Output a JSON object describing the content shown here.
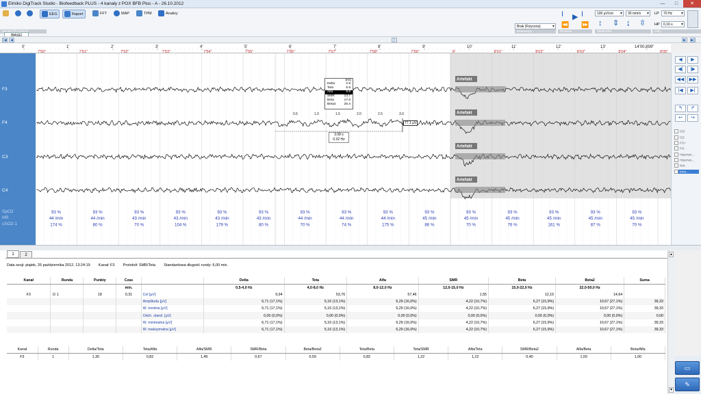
{
  "titlebar": {
    "title": "Elmiko DigiTrack Studio  -  Biofeedback PLUS  -  4 kanały z POX BFB Plus  -  A  -  26.10.2012",
    "minimize": "—",
    "maximize": "□",
    "close": "✕"
  },
  "toolbar": {
    "eeg": "EEG",
    "raport": "Raport",
    "fft": "FFT",
    "map": "MAP",
    "tpm": "TPM",
    "analizy": "Analizy",
    "montage_band": "Montaż [Programy]",
    "base_tab": "[BASE]",
    "referencja_select": "Brak (Fizyczna)",
    "referencja_band": "Referencja",
    "przesuw_band": "Przesuw",
    "skala_band": "Skala EEG",
    "filtry_band": "Filtry",
    "sensitivity": "100 µV/cm",
    "speed": "30 mm/s",
    "lp_label": "LP",
    "lp_value": "70 Hz",
    "hp_label": "HP",
    "hp_value": "0,16 s"
  },
  "timescale": {
    "ticks": [
      "0'",
      "1'",
      "2'",
      "3'",
      "4'",
      "5'",
      "6'",
      "7'",
      "8'",
      "9'",
      "10'",
      "11'",
      "12'",
      "13'",
      "14'00,899\""
    ],
    "epochs": [
      "7'50\"",
      "7'51\"",
      "7'52\"",
      "7'53\"",
      "7'54\"",
      "7'55\"",
      "7'56\"",
      "7'57\"",
      "7'58\"",
      "7'59\"",
      "8'",
      "8'01\"",
      "8'02\"",
      "8'03\"",
      "8'04\"",
      "8'05\""
    ]
  },
  "channels": [
    "F3",
    "F4",
    "C3",
    "C4"
  ],
  "artefakt_label": "Artefakt",
  "popup": {
    "unit": "[Hz]",
    "rows": [
      [
        "Delta",
        "2.9"
      ],
      [
        "Teta",
        "5.9"
      ],
      [
        "Alfa",
        "9.8"
      ],
      [
        "SMR",
        "13.7"
      ],
      [
        "Beta",
        "17.6"
      ],
      [
        "Beta2",
        "26.4"
      ]
    ],
    "scale": [
      "0.5",
      "1.0",
      "1.5",
      "2.0",
      "2.5",
      "3.0"
    ],
    "amplitude": "77.1 µV",
    "time": "3.08 s",
    "freq": "0.32 Hz"
  },
  "vitals": {
    "labels": [
      "SpO2",
      "HR",
      "cSO2-1"
    ],
    "columns": [
      [
        "93 %",
        "44 /min",
        "174 %"
      ],
      [
        "93 %",
        "44 /min",
        "80 %"
      ],
      [
        "93 %",
        "43 /min",
        "70 %"
      ],
      [
        "93 %",
        "43 /min",
        "104 %"
      ],
      [
        "93 %",
        "43 /min",
        "179 %"
      ],
      [
        "93 %",
        "43 /min",
        "80 %"
      ],
      [
        "93 %",
        "44 /min",
        "70 %"
      ],
      [
        "93 %",
        "44 /min",
        "74 %"
      ],
      [
        "93 %",
        "44 /min",
        "175 %"
      ],
      [
        "93 %",
        "45 /min",
        "86 %"
      ],
      [
        "93 %",
        "45 /min",
        "70 %"
      ],
      [
        "93 %",
        "45 /min",
        "76 %"
      ],
      [
        "93 %",
        "45 /min",
        "161 %"
      ],
      [
        "93 %",
        "45 /min",
        "87 %"
      ],
      [
        "93 %",
        "45 /min",
        "70 %"
      ]
    ]
  },
  "filters": [
    "OO",
    "OZ",
    "FS+",
    "FS-",
    "Hiperwe...",
    "Hiperwe...",
    "Not.",
    "Inne..."
  ],
  "bottom": {
    "tabs": [
      "1",
      "2"
    ],
    "session_info": "Data sesji: piątek, 26 października 2012, 13:24:19        Kanał: F3        Protokół: SMR/Teta        Standardowa długość rundy: 6,00 min.",
    "t1_headers": [
      "Kanał",
      "Runda",
      "Punkty",
      "Czas",
      "",
      "Delta",
      "Teta",
      "Alfa",
      "SMR",
      "Beta",
      "Beta2",
      "Suma"
    ],
    "t1_sub": [
      "",
      "",
      "",
      "min.",
      "",
      "0,5-4,0 Hz",
      "4,0-8,0 Hz",
      "8,0-12,0 Hz",
      "12,0-15,0 Hz",
      "15,0-22,0 Hz",
      "22,0-50,0 Hz",
      ""
    ],
    "t1_first": [
      "F3",
      "1",
      "18",
      "0,31"
    ],
    "t1_rows": [
      [
        "Cel [µV]",
        "9,94",
        "53,76",
        "57,46",
        "1,55",
        "12,15",
        "14,64",
        ""
      ],
      [
        "Amplituda [µV]",
        "6,71 (17,1%)",
        "5,16 (13,1%)",
        "6,29 (16,0%)",
        "4,22 (10,7%)",
        "6,27 (15,9%)",
        "10,67 (27,1%)",
        "39,33"
      ],
      [
        "W. średnia [µV]",
        "6,71 (17,1%)",
        "5,16 (13,1%)",
        "6,29 (16,0%)",
        "4,22 (10,7%)",
        "6,27 (15,9%)",
        "10,67 (27,1%)",
        "39,33"
      ],
      [
        "Odch. stand. [µV]",
        "0,00 (0,0%)",
        "0,00 (0,0%)",
        "0,00 (0,0%)",
        "0,00 (0,0%)",
        "0,00 (0,0%)",
        "0,00 (0,0%)",
        "0,00"
      ],
      [
        "W. minimalna [µV]",
        "6,71 (17,1%)",
        "5,16 (13,1%)",
        "6,29 (16,0%)",
        "4,22 (10,7%)",
        "6,27 (15,9%)",
        "10,67 (27,1%)",
        "39,33"
      ],
      [
        "W. maksymalna [µV]",
        "6,71 (17,1%)",
        "5,16 (13,1%)",
        "6,29 (16,0%)",
        "4,22 (10,7%)",
        "6,27 (15,9%)",
        "10,67 (27,1%)",
        "39,33"
      ]
    ],
    "t2_headers": [
      "Kanał",
      "Runda",
      "Delta/Teta",
      "Teta/Alfa",
      "Alfa/SMR",
      "SMR/Beta",
      "Beta/Beta2",
      "Teta/Beta",
      "Teta/SMR",
      "Alfa/Teta",
      "SMR/Beta2",
      "Alfa/Beta",
      "Beta/Alfa"
    ],
    "t2_row": [
      "F3",
      "1",
      "1,30",
      "0,82",
      "1,49",
      "0,67",
      "0,59",
      "0,82",
      "1,22",
      "1,22",
      "0,40",
      "1,00",
      "1,00"
    ]
  }
}
